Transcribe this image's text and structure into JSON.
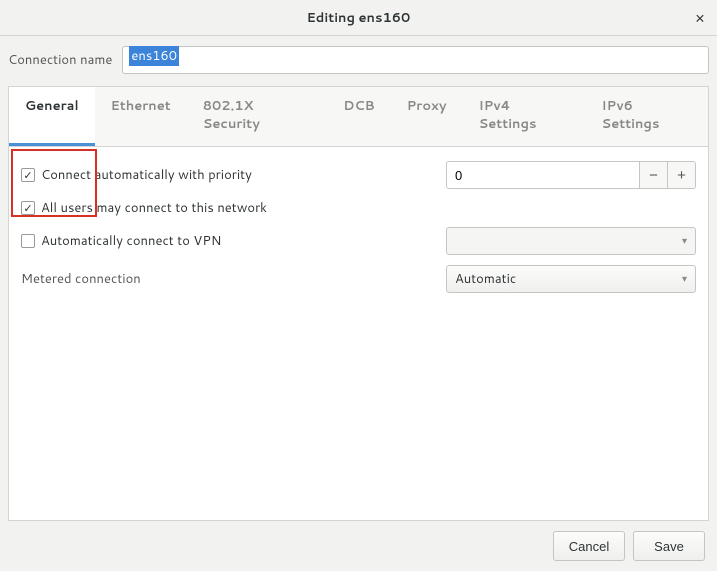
{
  "titlebar": {
    "title": "Editing ens160"
  },
  "connection_name": {
    "label": "Connection name",
    "value": "ens160"
  },
  "tabs": [
    {
      "label": "General",
      "active": true
    },
    {
      "label": "Ethernet",
      "active": false
    },
    {
      "label": "802.1X Security",
      "active": false
    },
    {
      "label": "DCB",
      "active": false
    },
    {
      "label": "Proxy",
      "active": false
    },
    {
      "label": "IPv4 Settings",
      "active": false
    },
    {
      "label": "IPv6 Settings",
      "active": false
    }
  ],
  "general": {
    "auto_connect": {
      "label": "Connect automatically with priority",
      "checked": true,
      "priority": "0"
    },
    "all_users": {
      "label": "All users may connect to this network",
      "checked": true
    },
    "auto_vpn": {
      "label": "Automatically connect to VPN",
      "checked": false,
      "vpn_selected": ""
    },
    "metered": {
      "label": "Metered connection",
      "value": "Automatic"
    }
  },
  "footer": {
    "cancel": "Cancel",
    "save": "Save"
  }
}
